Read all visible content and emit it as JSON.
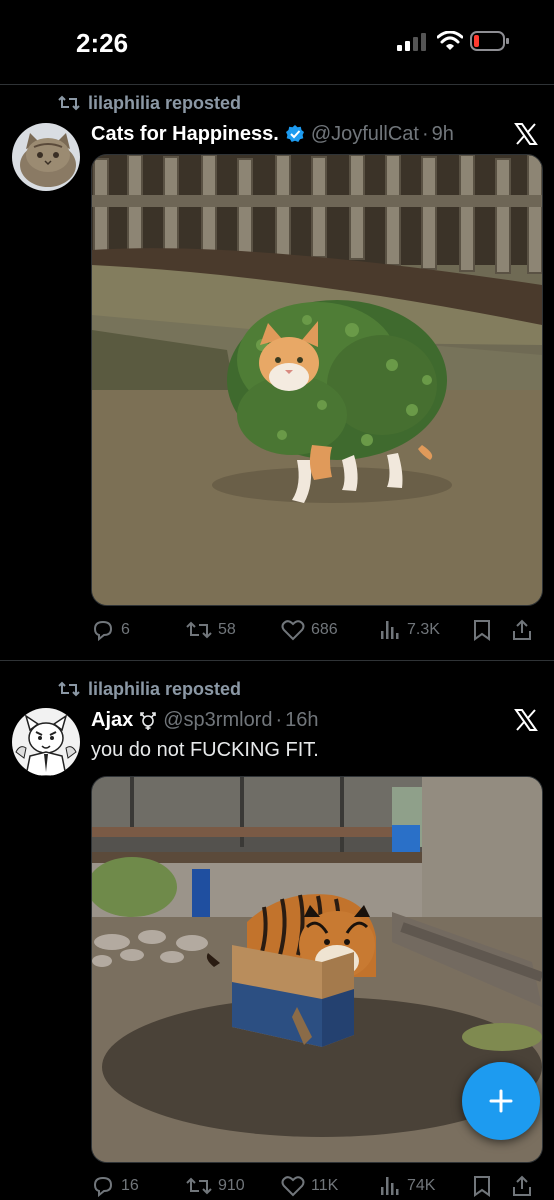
{
  "status_bar": {
    "time": "2:26"
  },
  "posts": [
    {
      "repost_label": "lilaphilia reposted",
      "display_name": "Cats for Happiness.",
      "verified": true,
      "handle": "@JoyfullCat",
      "separator": "·",
      "age": "9h",
      "text": "",
      "media": "photo of an orange-and-white cat wearing a round green bush",
      "stats": {
        "replies": "6",
        "reposts": "58",
        "likes": "686",
        "views": "7.3K"
      }
    },
    {
      "repost_label": "lilaphilia reposted",
      "display_name": "Ajax",
      "handle": "@sp3rmlord",
      "separator": "·",
      "age": "16h",
      "text": "you do not FUCKING FIT.",
      "media": "photo of a tiger standing in a small cardboard box",
      "stats": {
        "replies": "16",
        "reposts": "910",
        "likes": "11K",
        "views": "74K"
      }
    }
  ],
  "icons": [
    "repost-icon",
    "verified-badge-icon",
    "gender-symbol-icon",
    "x-logo-icon",
    "reply-icon",
    "like-icon",
    "views-icon",
    "bookmark-icon",
    "share-icon",
    "plus-icon"
  ],
  "colors": {
    "background": "#000000",
    "accent": "#1d9bf0",
    "muted": "#71767b",
    "text": "#e7e9ea"
  }
}
